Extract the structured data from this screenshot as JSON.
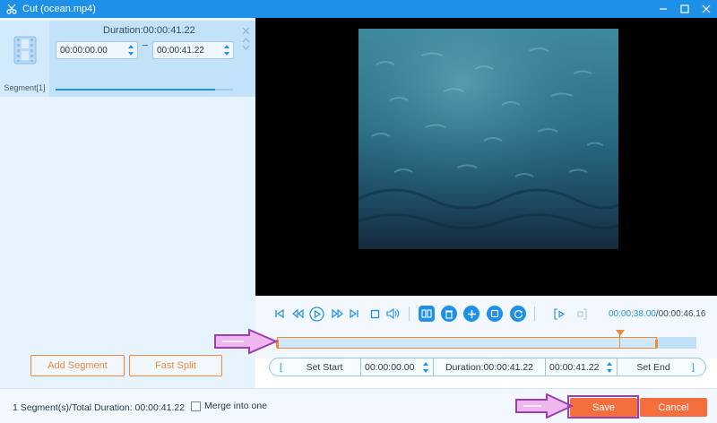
{
  "window": {
    "title": "Cut (ocean.mp4)",
    "icons": [
      "scissors-icon",
      "minimize-icon",
      "maximize-icon",
      "close-icon"
    ]
  },
  "segment_panel": {
    "segment_label": "Segment[1]",
    "duration_text": "Duration:00:00:41.22",
    "start_time": "00:00:00.00",
    "end_time": "00:00:41.22",
    "progress_fraction": 0.9
  },
  "left_buttons": {
    "add_segment": "Add Segment",
    "fast_split": "Fast Split"
  },
  "player": {
    "current_time": "00:00:38.00",
    "total_time": "/00:00:46.16",
    "controls": [
      "skip-start-icon",
      "step-back-icon",
      "play-icon",
      "step-forward-icon",
      "skip-end-icon",
      "stop-icon",
      "volume-icon",
      "split-icon",
      "delete-icon",
      "add-icon",
      "copy-icon",
      "reset-icon",
      "mark-in-icon",
      "mark-out-icon"
    ]
  },
  "timeline": {
    "selection_fraction": 0.906,
    "playhead_fraction": 0.816
  },
  "set_bar": {
    "set_start": "Set Start",
    "start_time": "00:00:00.00",
    "duration": "Duration:00:00:41.22",
    "end_time": "00:00:41.22",
    "set_end": "Set End",
    "bracket_open": "[",
    "bracket_close": "]"
  },
  "footer": {
    "status": "1 Segment(s)/Total Duration: 00:00:41.22",
    "merge_label": "Merge into one",
    "merge_checked": false,
    "save": "Save",
    "cancel": "Cancel"
  },
  "colors": {
    "accent": "#1e90e8",
    "orange": "#f08a3a",
    "save_bg": "#f46f3c",
    "annotation_arrow": "#e8a8e0"
  }
}
